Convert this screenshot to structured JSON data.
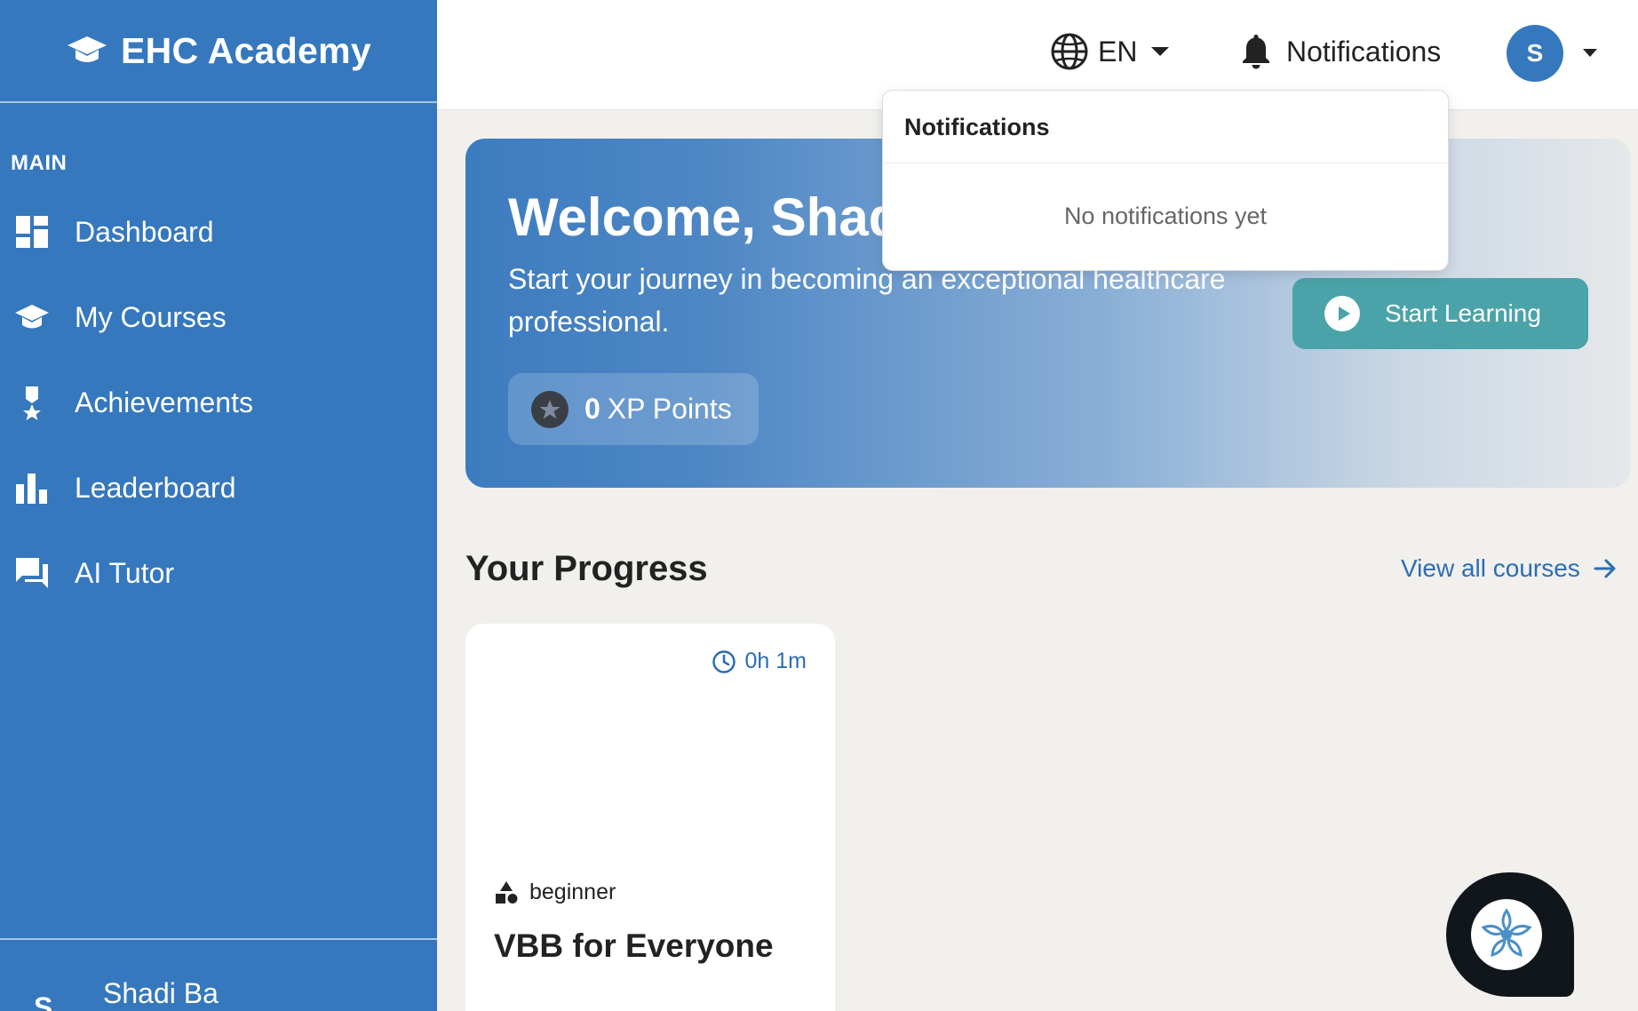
{
  "sidebar": {
    "brand": "EHC Academy",
    "section_label": "MAIN",
    "items": [
      {
        "label": "Dashboard",
        "icon": "dashboard-icon"
      },
      {
        "label": "My Courses",
        "icon": "graduation-cap-icon"
      },
      {
        "label": "Achievements",
        "icon": "medal-icon"
      },
      {
        "label": "Leaderboard",
        "icon": "bar-chart-icon"
      },
      {
        "label": "AI Tutor",
        "icon": "chat-icon"
      }
    ],
    "user": {
      "initial": "S",
      "name": "Shadi Ba"
    }
  },
  "topbar": {
    "language": "EN",
    "notifications_label": "Notifications",
    "avatar_initial": "S"
  },
  "notifications_dropdown": {
    "title": "Notifications",
    "empty_text": "No notifications yet"
  },
  "banner": {
    "welcome": "Welcome, Shadi",
    "subtitle": "Start your journey in becoming an exceptional healthcare professional.",
    "xp_value": "0",
    "xp_label": "XP Points",
    "start_button": "Start Learning"
  },
  "progress": {
    "title": "Your Progress",
    "view_all": "View all courses",
    "courses": [
      {
        "duration": "0h 1m",
        "level": "beginner",
        "title": "VBB for Everyone"
      }
    ]
  },
  "colors": {
    "sidebar": "#3578be",
    "accent": "#2c6db3",
    "start_button": "#4aa3a8",
    "background": "#f1f0ed"
  }
}
